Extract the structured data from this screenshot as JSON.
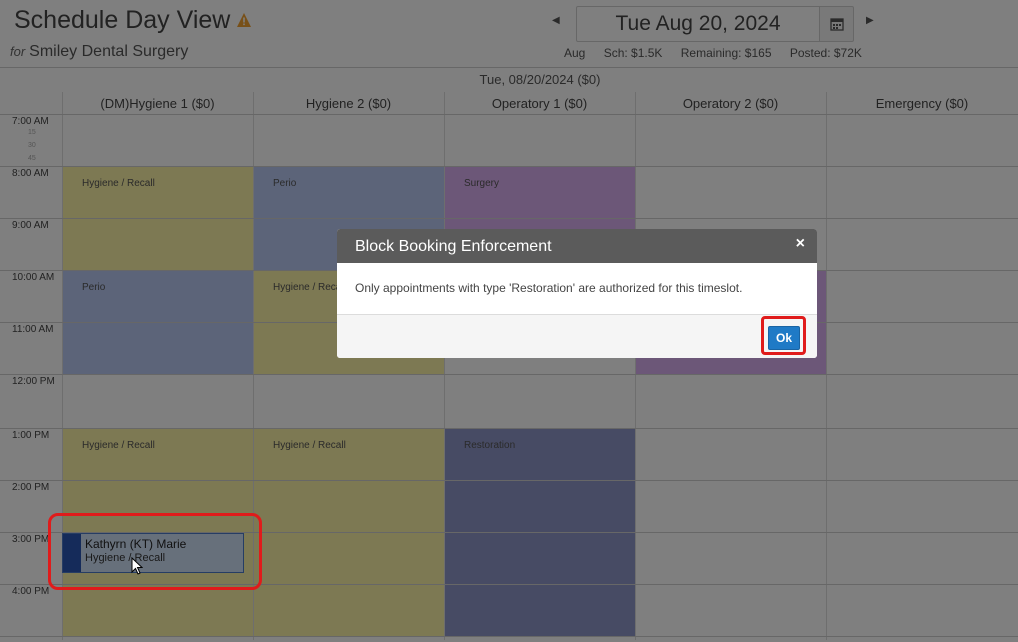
{
  "header": {
    "title": "Schedule Day View",
    "subtitle_prefix": "for",
    "practice_name": "Smiley Dental Surgery",
    "current_date": "Tue Aug 20, 2024",
    "stats": {
      "month": "Aug",
      "scheduled": "Sch: $1.5K",
      "remaining": "Remaining: $165",
      "posted": "Posted: $72K"
    }
  },
  "grid": {
    "date_header": "Tue, 08/20/2024 ($0)",
    "columns": [
      "(DM)Hygiene 1 ($0)",
      "Hygiene 2 ($0)",
      "Operatory 1 ($0)",
      "Operatory 2 ($0)",
      "Emergency ($0)"
    ],
    "hours": [
      "7:00 AM",
      "8:00 AM",
      "9:00 AM",
      "10:00 AM",
      "11:00 AM",
      "12:00 PM",
      "1:00 PM",
      "2:00 PM",
      "3:00 PM",
      "4:00 PM"
    ],
    "quarters": [
      "15",
      "30",
      "45"
    ],
    "blocks": [
      {
        "label": "Hygiene / Recall"
      },
      {
        "label": "Perio"
      },
      {
        "label": "Surgery"
      },
      {
        "label": "Perio"
      },
      {
        "label": "Hygiene / Recall"
      },
      {
        "label": "Hygiene / Recall"
      },
      {
        "label": "Hygiene / Recall"
      },
      {
        "label": "Restoration"
      }
    ],
    "appointment": {
      "name": "Kathyrn (KT) Marie",
      "type": "Hygiene / Recall"
    }
  },
  "modal": {
    "title": "Block Booking Enforcement",
    "close_label": "×",
    "message": "Only appointments with type 'Restoration' are authorized for this timeslot.",
    "ok_label": "Ok"
  },
  "colors": {
    "hygiene_block": "#fbf2a6",
    "perio_block": "#b8c8f2",
    "surgery_block": "#d9aef0",
    "restoration_block": "#8f97c8",
    "highlight": "#e01b1b",
    "ok_button": "#1f7ac6"
  }
}
